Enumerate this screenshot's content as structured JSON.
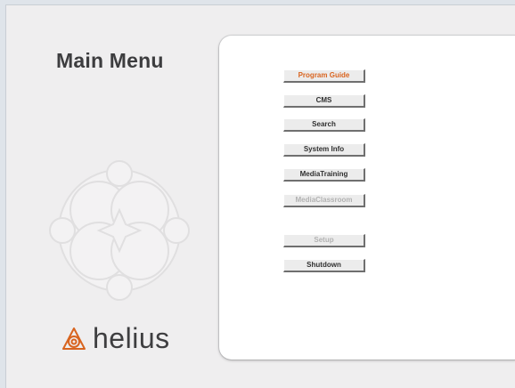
{
  "menu": {
    "title": "Main Menu",
    "buttons": [
      {
        "label": "Program Guide",
        "state": "active"
      },
      {
        "label": "CMS",
        "state": "normal"
      },
      {
        "label": "Search",
        "state": "normal"
      },
      {
        "label": "System Info",
        "state": "normal"
      },
      {
        "label": "MediaTraining",
        "state": "normal"
      },
      {
        "label": "MediaClassroom",
        "state": "disabled"
      },
      {
        "label": "Setup",
        "state": "disabled"
      },
      {
        "label": "Shutdown",
        "state": "normal"
      }
    ]
  },
  "brand": {
    "name": "helius",
    "logo_icon": "helius-logo-icon",
    "watermark_icon": "helius-watermark-icon"
  },
  "colors": {
    "background": "#dfe4ea",
    "frame": "#efeeef",
    "panel": "#ffffff",
    "accent": "#d9641f",
    "disabled_text": "#b2b2b2"
  }
}
